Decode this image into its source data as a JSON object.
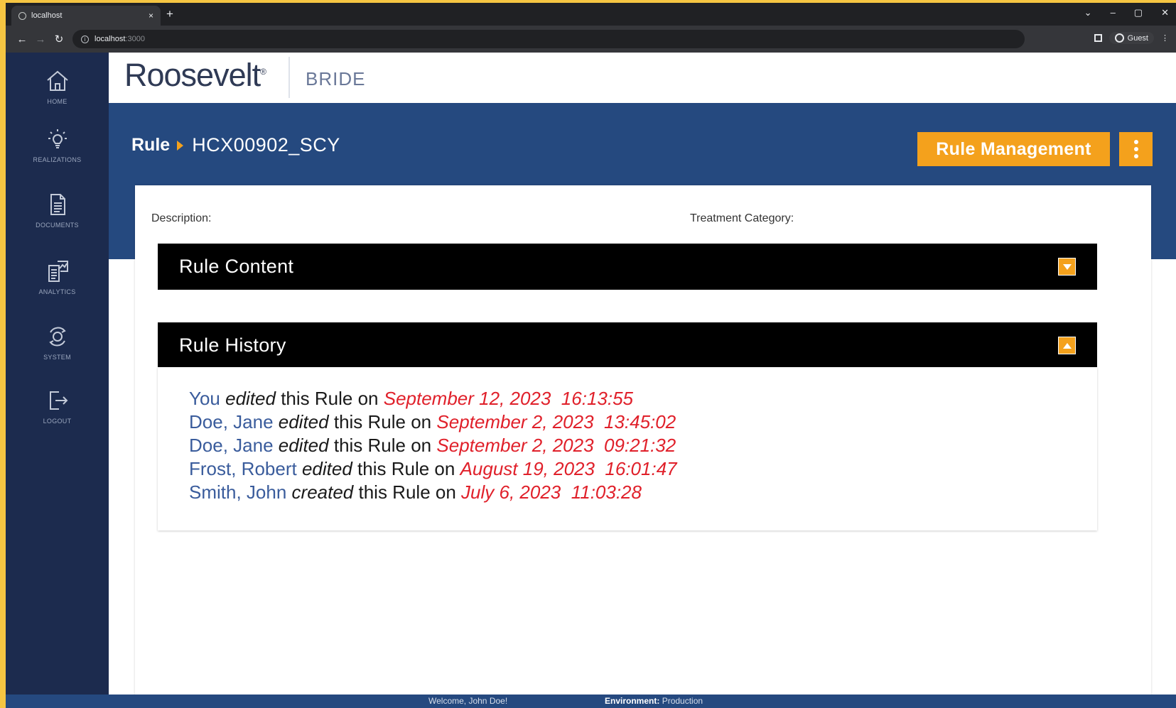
{
  "browser": {
    "tab_title": "localhost",
    "tab_close": "×",
    "new_tab": "+",
    "url_host": "localhost",
    "url_port": ":3000",
    "guest_label": "Guest",
    "window_controls": [
      "⌄",
      "–",
      "▢",
      "✕"
    ]
  },
  "sidebar": {
    "items": [
      {
        "label": "HOME",
        "icon": "home-icon"
      },
      {
        "label": "REALIZATIONS",
        "icon": "lightbulb-icon"
      },
      {
        "label": "DOCUMENTS",
        "icon": "document-icon"
      },
      {
        "label": "ANALYTICS",
        "icon": "analytics-icon"
      },
      {
        "label": "SYSTEM",
        "icon": "system-icon"
      },
      {
        "label": "LOGOUT",
        "icon": "logout-icon"
      }
    ]
  },
  "header": {
    "logo": "Roosevelt",
    "logo_mark": "®",
    "product": "BRIDE"
  },
  "page": {
    "breadcrumb_root": "Rule",
    "breadcrumb_leaf": "HCX00902_SCY",
    "rule_management_label": "Rule Management"
  },
  "details": {
    "description_label": "Description:",
    "treatment_category_label": "Treatment Category:"
  },
  "sections": {
    "rule_content_title": "Rule Content",
    "rule_history_title": "Rule History"
  },
  "history": [
    {
      "who": "You",
      "verb": "edited",
      "middle": "this Rule on",
      "when": "September 12, 2023  16:13:55"
    },
    {
      "who": "Doe, Jane",
      "verb": "edited",
      "middle": "this Rule on",
      "when": "September 2, 2023  13:45:02"
    },
    {
      "who": "Doe, Jane",
      "verb": "edited",
      "middle": "this Rule on",
      "when": "September 2, 2023  09:21:32"
    },
    {
      "who": "Frost, Robert",
      "verb": "edited",
      "middle": "this Rule on",
      "when": "August 19, 2023  16:01:47"
    },
    {
      "who": "Smith, John",
      "verb": "created",
      "middle": "this Rule on",
      "when": "July 6, 2023  11:03:28"
    }
  ],
  "footer": {
    "welcome": "Welcome, John Doe!",
    "environment_label": "Environment:",
    "environment_value": "Production"
  },
  "colors": {
    "sidebar_bg": "#1c2b4e",
    "band_bg": "#25497f",
    "accent_orange": "#f4a11c",
    "history_name_blue": "#3a5c9c",
    "history_date_red": "#e0202a"
  }
}
